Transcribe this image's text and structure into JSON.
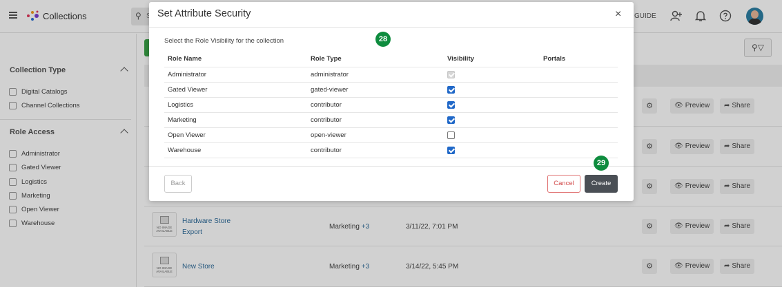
{
  "app": {
    "title": "Collections",
    "search_placeholder": "S",
    "guide_label": "GUIDE"
  },
  "sidebar": {
    "collection_type": {
      "title": "Collection Type",
      "items": [
        "Digital Catalogs",
        "Channel Collections"
      ]
    },
    "role_access": {
      "title": "Role Access",
      "items": [
        "Administrator",
        "Gated Viewer",
        "Logistics",
        "Marketing",
        "Open Viewer",
        "Warehouse"
      ]
    }
  },
  "rows": [
    {
      "name": "",
      "role": "",
      "more": "",
      "date": ""
    },
    {
      "name": "",
      "role": "",
      "more": "",
      "date": ""
    },
    {
      "name": "",
      "role": "",
      "more": "",
      "date": ""
    },
    {
      "name": "Hardware Store",
      "name2": "Export",
      "role": "Marketing",
      "more": "+3",
      "date": "3/11/22, 7:01 PM"
    },
    {
      "name": "New Store",
      "role": "Marketing",
      "more": "+3",
      "date": "3/14/22, 5:45 PM"
    }
  ],
  "row_actions": {
    "preview": "Preview",
    "share": "Share",
    "no_image": "NO IMAGE AVAILABLE"
  },
  "modal": {
    "title": "Set Attribute Security",
    "close": "×",
    "subtitle": "Select the Role Visibility for the collection",
    "badge_top": "28",
    "badge_bottom": "29",
    "columns": [
      "Role Name",
      "Role Type",
      "Visibility",
      "Portals"
    ],
    "roles": [
      {
        "name": "Administrator",
        "type": "administrator",
        "visible": true,
        "disabled": true
      },
      {
        "name": "Gated Viewer",
        "type": "gated-viewer",
        "visible": true,
        "disabled": false
      },
      {
        "name": "Logistics",
        "type": "contributor",
        "visible": true,
        "disabled": false
      },
      {
        "name": "Marketing",
        "type": "contributor",
        "visible": true,
        "disabled": false
      },
      {
        "name": "Open Viewer",
        "type": "open-viewer",
        "visible": false,
        "disabled": false
      },
      {
        "name": "Warehouse",
        "type": "contributor",
        "visible": true,
        "disabled": false
      }
    ],
    "back_label": "Back",
    "cancel_label": "Cancel",
    "create_label": "Create"
  },
  "colors": {
    "badge": "#0e8c3e",
    "checkbox_checked": "#2068c8",
    "create_button": "#4a4f55",
    "cancel_text": "#d24b4b",
    "link": "#2f6c9a"
  }
}
